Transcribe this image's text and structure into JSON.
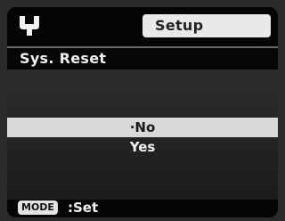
{
  "header": {
    "icon": "wrench-icon",
    "title": "Setup"
  },
  "subtitle": "Sys. Reset",
  "options": [
    {
      "label": "·No",
      "selected": true
    },
    {
      "label": "Yes",
      "selected": false
    }
  ],
  "footer": {
    "button_label": "MODE",
    "action_text": ":Set"
  },
  "colors": {
    "background": "#060606",
    "highlight": "#d9d9d9",
    "text": "#f1f1f1"
  }
}
